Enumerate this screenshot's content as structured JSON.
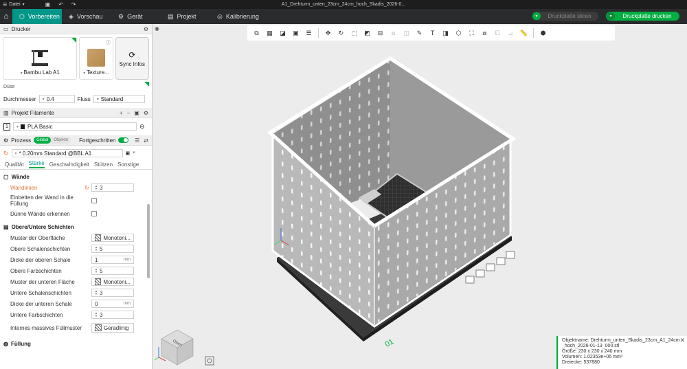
{
  "titlebar": {
    "menu_label": "Datei",
    "window_title": "A1_Drehturm_unten_23cm_24cm_hoch_Skadis_2026-0..."
  },
  "tabs": [
    {
      "label": "Vorbereiten",
      "icon": "cube-icon",
      "active": true
    },
    {
      "label": "Vorschau",
      "icon": "layers-icon",
      "active": false
    },
    {
      "label": "Gerät",
      "icon": "sliders-icon",
      "active": false
    },
    {
      "label": "Projekt",
      "icon": "document-icon",
      "active": false
    },
    {
      "label": "Kalibrierung",
      "icon": "calibration-icon",
      "active": false
    }
  ],
  "actions": {
    "slice_label": "Druckplatte slicen",
    "print_label": "Druckplatte drucken"
  },
  "printer": {
    "section_title": "Drucker",
    "printer_name": "Bambu Lab A1",
    "plate_name": "Texture...",
    "sync_label": "Sync Infos",
    "nozzle_section": "Düse",
    "diameter_label": "Durchmesser",
    "diameter_value": "0.4",
    "flow_label": "Fluss",
    "flow_value": "Standard"
  },
  "filaments": {
    "section_title": "Projekt Filamente",
    "items": [
      {
        "index": "1",
        "name": "PLA Basic",
        "color": "#1a1a1a"
      }
    ]
  },
  "process": {
    "section_title": "Prozess",
    "mode_global": "Global",
    "mode_objects": "Objekte",
    "advanced_label": "Fortgeschritten",
    "preset": "* 0.20mm Standard @BBL A1",
    "subtabs": [
      "Qualität",
      "Stärke",
      "Geschwindigkeit",
      "Stützen",
      "Sonstige"
    ],
    "active_subtab": "Stärke"
  },
  "walls": {
    "title": "Wände",
    "wall_lines_label": "Wandlinien",
    "wall_lines_value": "3",
    "embed_label": "Einbetten der Wand in die Füllung",
    "thin_label": "Dünne Wände erkennen"
  },
  "shells": {
    "title": "Obere/Untere Schichten",
    "rows": [
      {
        "label": "Muster der Oberfläche",
        "value": "Monotoni...",
        "kind": "pattern"
      },
      {
        "label": "Obere Schalenschichten",
        "value": "5",
        "kind": "spin"
      },
      {
        "label": "Dicke der oberen Schale",
        "value": "1",
        "unit": "mm",
        "kind": "unit"
      },
      {
        "label": "Obere Farbschichten",
        "value": "5",
        "kind": "spin"
      },
      {
        "label": "Muster der unteren Fläche",
        "value": "Monotoni...",
        "kind": "pattern"
      },
      {
        "label": "Untere Schalenschichten",
        "value": "3",
        "kind": "spin"
      },
      {
        "label": "Dicke der unteren Schale",
        "value": "0",
        "unit": "mm",
        "kind": "unit"
      },
      {
        "label": "Untere Farbschichten",
        "value": "3",
        "kind": "spin"
      },
      {
        "label": "Internes massives Füllmuster",
        "value": "Geradlinig",
        "kind": "pattern"
      }
    ]
  },
  "infill": {
    "title": "Füllung"
  },
  "viewport": {
    "plate_number": "01",
    "cube_label": "Oben",
    "info": {
      "name_line1": "Objektname: Drehturm_unten_Skadis_23cm_A1_24cm",
      "name_line2": "_hoch_2026-01-13_000.stl",
      "size": "Größe: 230 x 230 x 240 mm",
      "volume": "Volumen: 1.02353e+06 mm³",
      "triangles": "Dreiecke: 537880"
    }
  },
  "colors": {
    "accent": "#00ae42",
    "tab_active": "#009688",
    "warning": "#e07a3f"
  }
}
